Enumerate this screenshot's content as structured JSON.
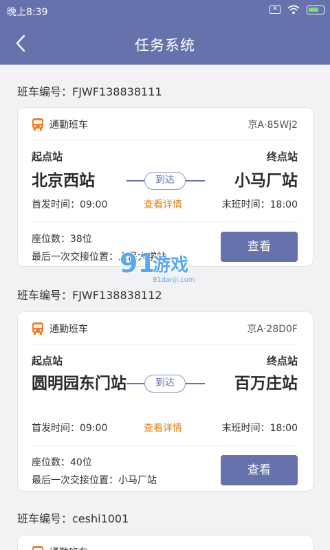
{
  "status": {
    "time": "晚上8:39",
    "sim_icon": "x-box-icon",
    "wifi_icon": "wifi-icon",
    "battery_icon": "battery-charging-icon"
  },
  "header": {
    "title": "任务系统",
    "back_icon": "chevron-left-icon"
  },
  "colors": {
    "accent": "#6672ab",
    "link": "#e0801e",
    "bus_icon": "#f07e2a"
  },
  "labels": {
    "start": "起点站",
    "end": "终点站",
    "arrive": "到达",
    "detail": "查看详情",
    "view": "查看"
  },
  "shifts": [
    {
      "title": "班车编号：FJWF138838111",
      "type": "通勤班车",
      "plate": "京A·85Wj2",
      "start_station": "北京西站",
      "end_station": "小马厂站",
      "first_time": "首发时间：09:00",
      "last_time": "末班时间：18:00",
      "seats": "座位数：38位",
      "handover": "最后一次交接位置：人民大学站"
    },
    {
      "title": "班车编号：FJWF138838112",
      "type": "通勤班车",
      "plate": "京A·28D0F",
      "start_station": "圆明园东门站",
      "end_station": "百万庄站",
      "first_time": "首发时间：09:00",
      "last_time": "末班时间：18:00",
      "seats": "座位数：40位",
      "handover": "最后一次交接位置：小马厂站"
    },
    {
      "title": "班车编号：ceshi1001",
      "type": "通勤班车"
    }
  ],
  "watermark": {
    "logo_text": "91游戏",
    "site": "91danji.com"
  }
}
